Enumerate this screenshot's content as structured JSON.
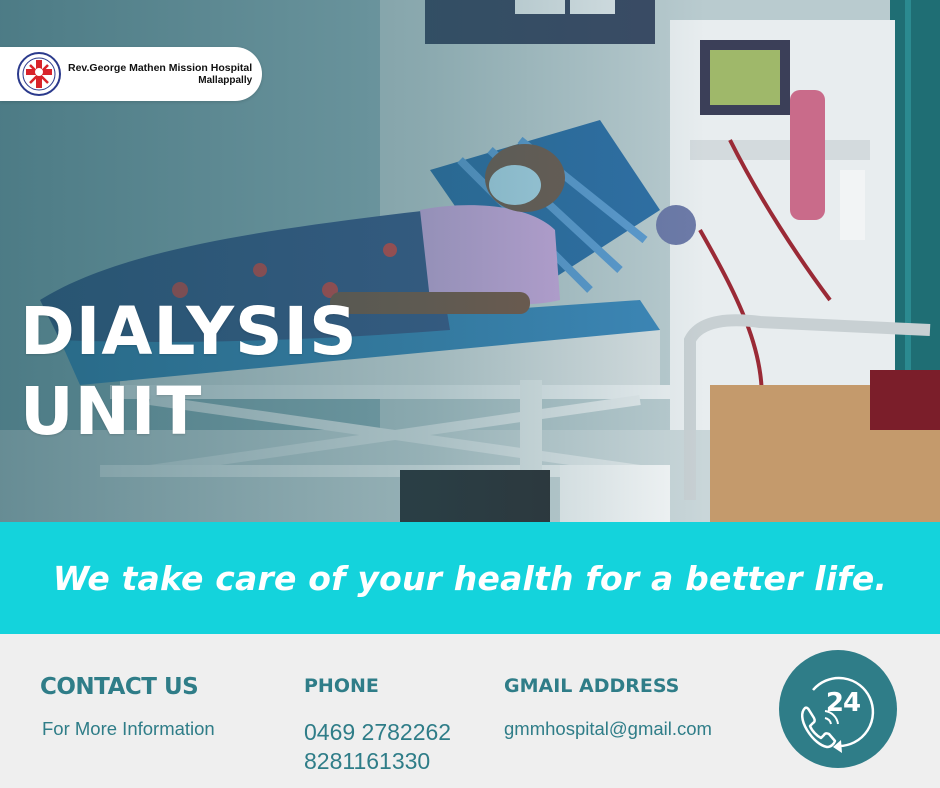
{
  "logo": {
    "name": "Rev.George Mathen Mission Hospital",
    "place": "Mallappally"
  },
  "title": {
    "line1": "DIALYSIS",
    "line2": "UNIT"
  },
  "tagline": "We take care of your health for a better life.",
  "contact": {
    "heading": "CONTACT US",
    "subheading": "For More Information"
  },
  "phone": {
    "heading": "PHONE",
    "numbers": [
      "0469 2782262",
      "8281161330"
    ]
  },
  "email": {
    "heading": "GMAIL ADDRESS",
    "value": "gmmhospital@gmail.com"
  },
  "badge": {
    "label": "24"
  },
  "colors": {
    "accent_teal": "#2f7d88",
    "band_cyan": "#14d3dc",
    "logo_red": "#d8232a"
  },
  "icons": [
    "hospital-seal-icon",
    "phone-24h-icon"
  ]
}
